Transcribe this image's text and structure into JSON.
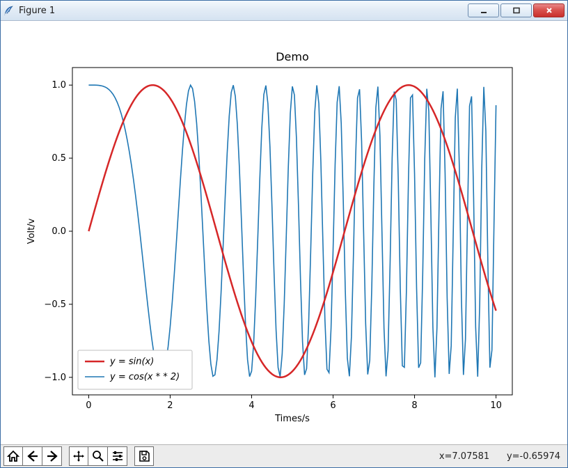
{
  "window": {
    "title": "Figure 1"
  },
  "toolbar": {
    "coord_readout": "x=7.07581      y=-0.65974"
  },
  "chart_data": {
    "type": "line",
    "title": "Demo",
    "xlabel": "Times/s",
    "ylabel": "Volt/v",
    "xlim": [
      -0.4,
      10.4
    ],
    "ylim": [
      -1.12,
      1.12
    ],
    "xticks": [
      0,
      2,
      4,
      6,
      8,
      10
    ],
    "yticks": [
      -1.0,
      -0.5,
      0.0,
      0.5,
      1.0
    ],
    "legend_position": "lower-left-inside",
    "series": [
      {
        "name": "y = sin(x)",
        "color": "#d62728",
        "linewidth": 2.5,
        "function": "sin(x)",
        "x_range": [
          0,
          10
        ],
        "samples": 201
      },
      {
        "name": "y = cos(x * * 2)",
        "color": "#1f77b4",
        "linewidth": 1.6,
        "function": "cos(x*x)",
        "x_range": [
          0,
          10
        ],
        "samples": 201
      }
    ]
  }
}
